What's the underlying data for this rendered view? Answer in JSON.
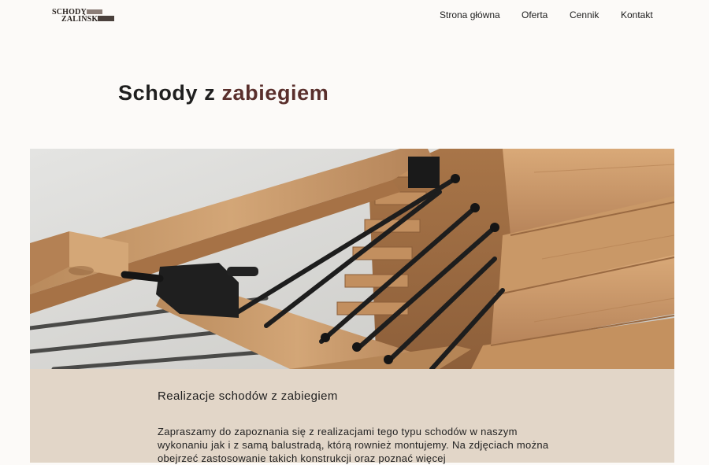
{
  "logo": {
    "line1": "SCHODY",
    "line2": "ZALIŃSKI"
  },
  "nav": {
    "items": [
      {
        "label": "Strona główna"
      },
      {
        "label": "Oferta"
      },
      {
        "label": "Cennik"
      },
      {
        "label": "Kontakt"
      }
    ]
  },
  "page": {
    "title_plain": "Schody z ",
    "title_accent": "zabiegiem",
    "accent_color": "#5a2f2c"
  },
  "section": {
    "title": "Realizacje schodów z zabiegiem",
    "text": "Zapraszamy do zapoznania się z realizacjami tego typu schodów w naszym wykonaniu jak i z samą balustradą, którą rownież montujemy. Na zdjęciach można obejrzeć zastosowanie takich konstrukcji oraz poznać więcej"
  },
  "colors": {
    "background": "#fcfaf8",
    "content_band": "#e2d6c8",
    "wood": "#c79868"
  }
}
